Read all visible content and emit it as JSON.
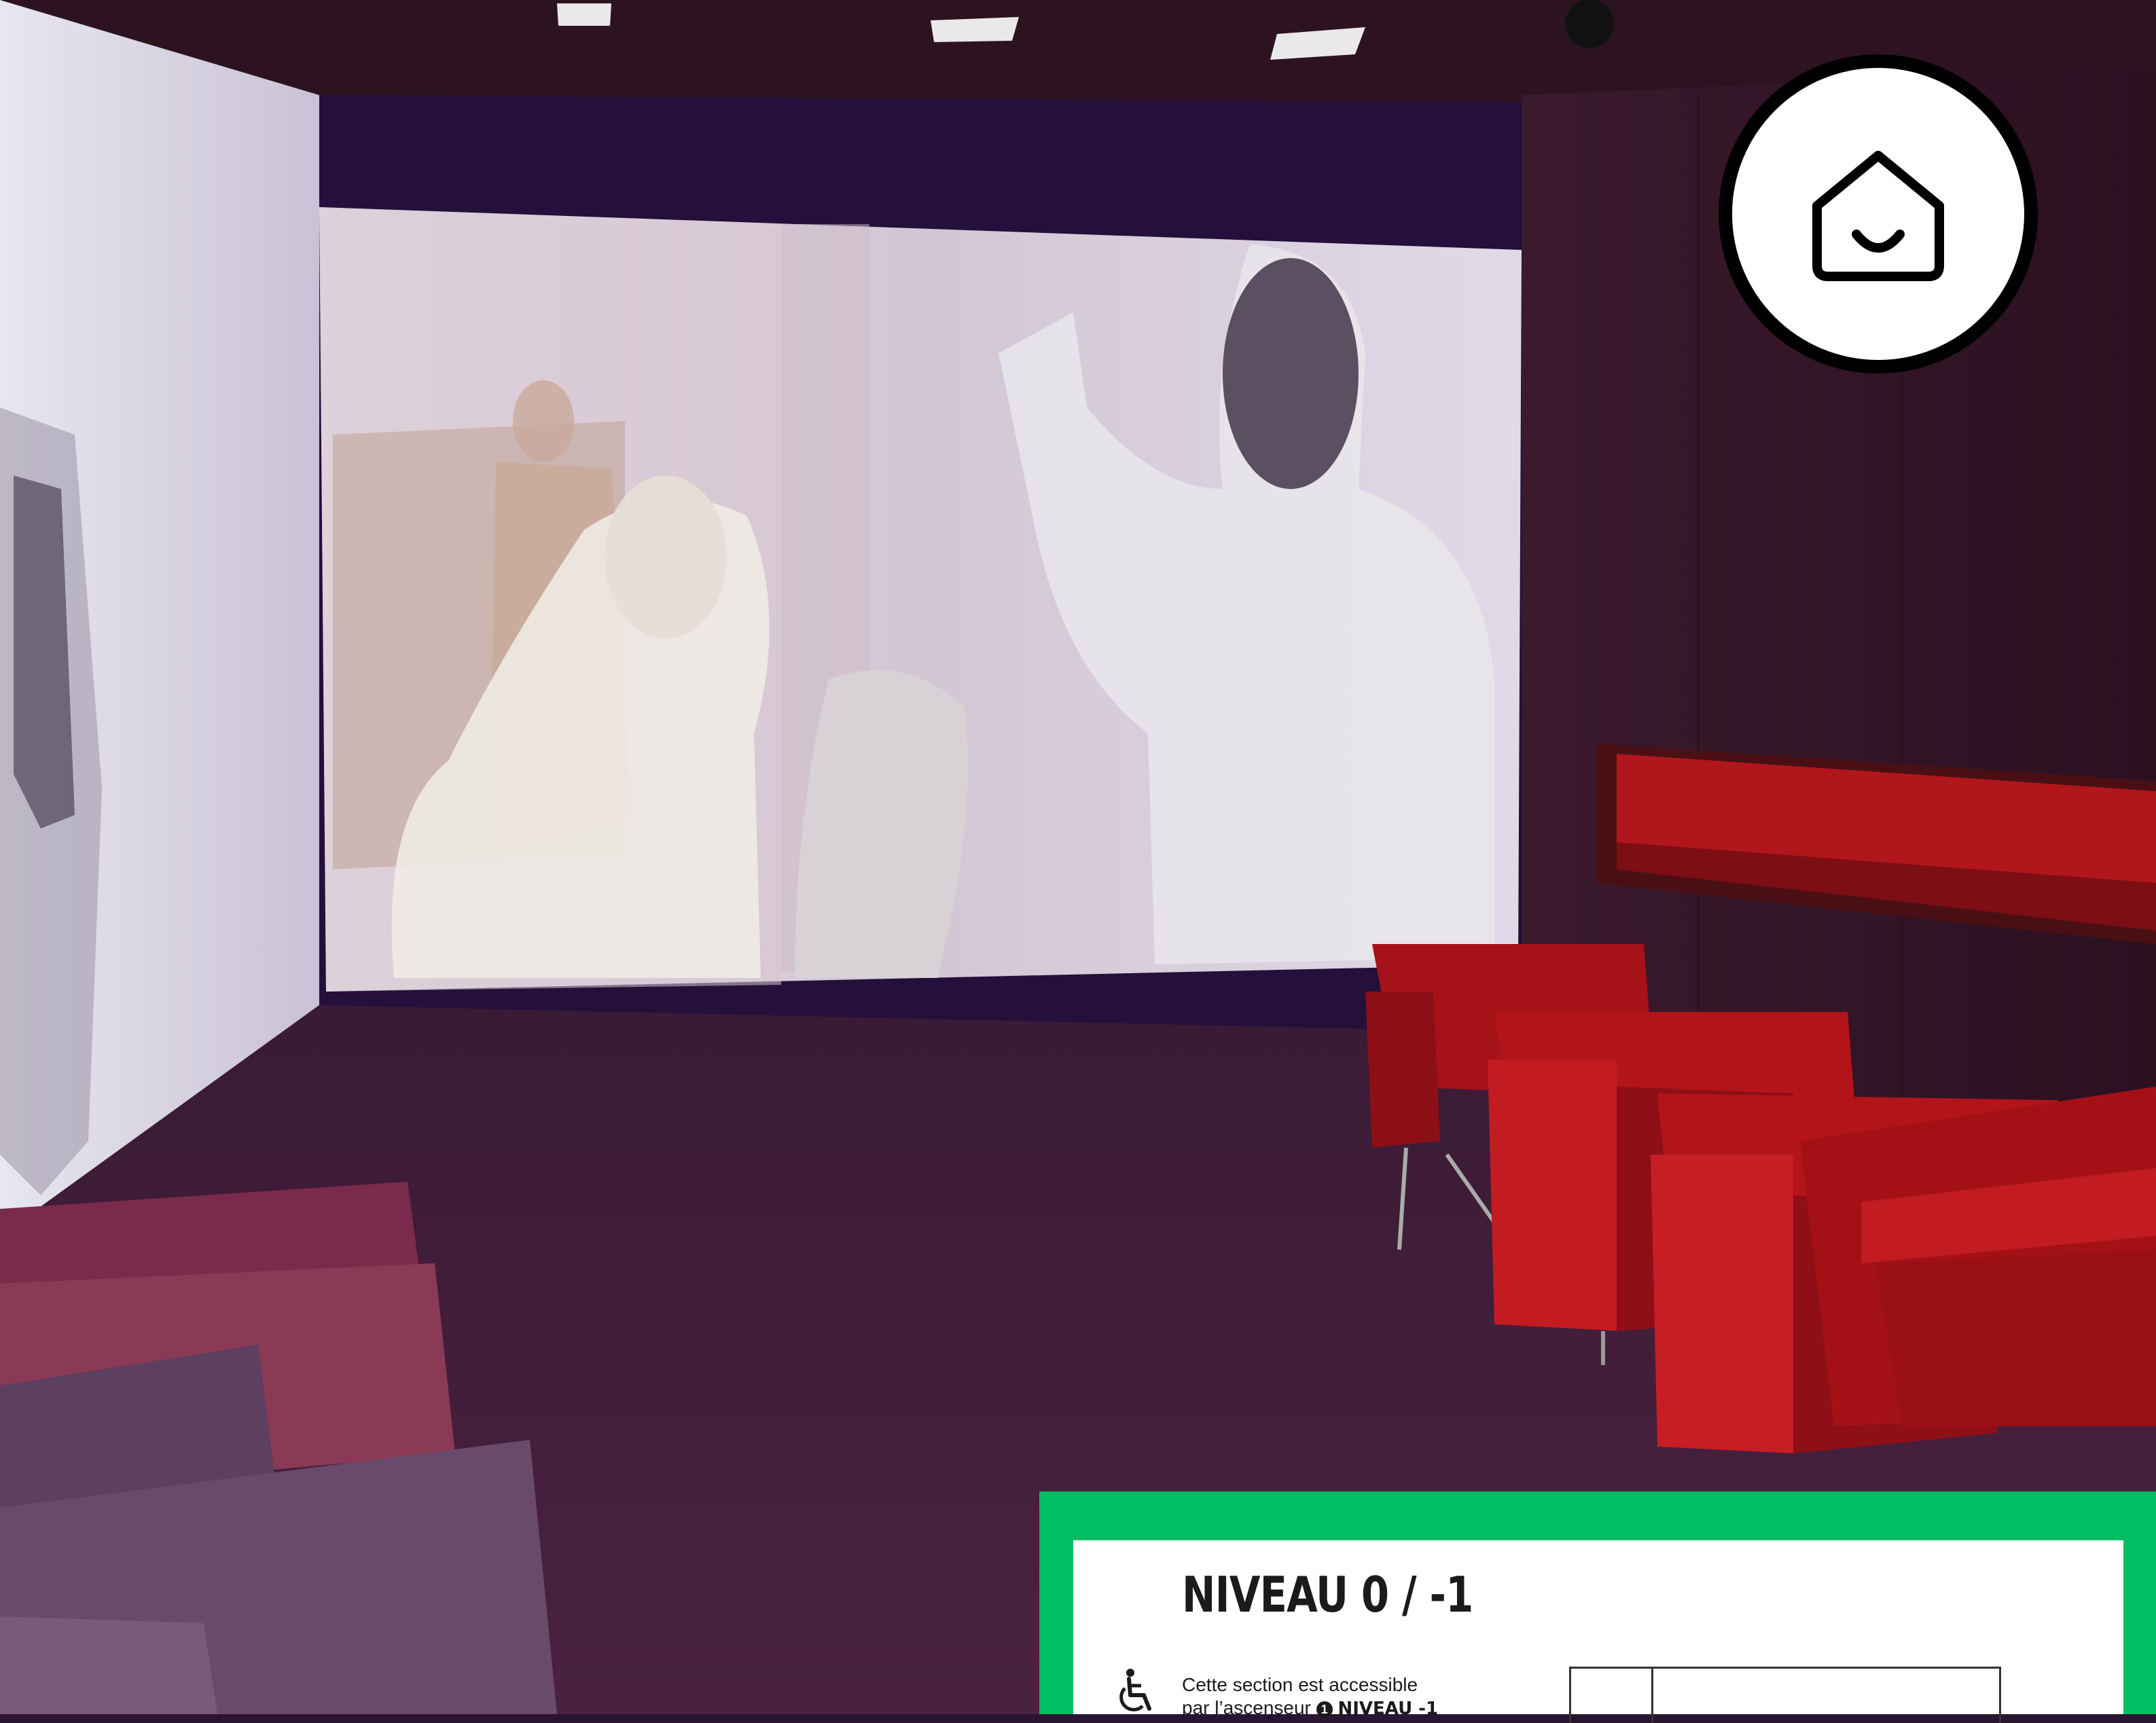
{
  "card": {
    "title": "NIVEAU 0 / -1",
    "access_line_1": "Cette section est accessible",
    "access_line_2_prefix": "par l’ascenseur",
    "level_badge": "1",
    "level_name": "NIVEAU -1"
  },
  "icons": {
    "home": "home-smile-icon",
    "wheelchair": "wheelchair-icon"
  },
  "colors": {
    "card_border": "#00be64",
    "chairs": "#b3141a",
    "screen": "#d8d2e0"
  }
}
